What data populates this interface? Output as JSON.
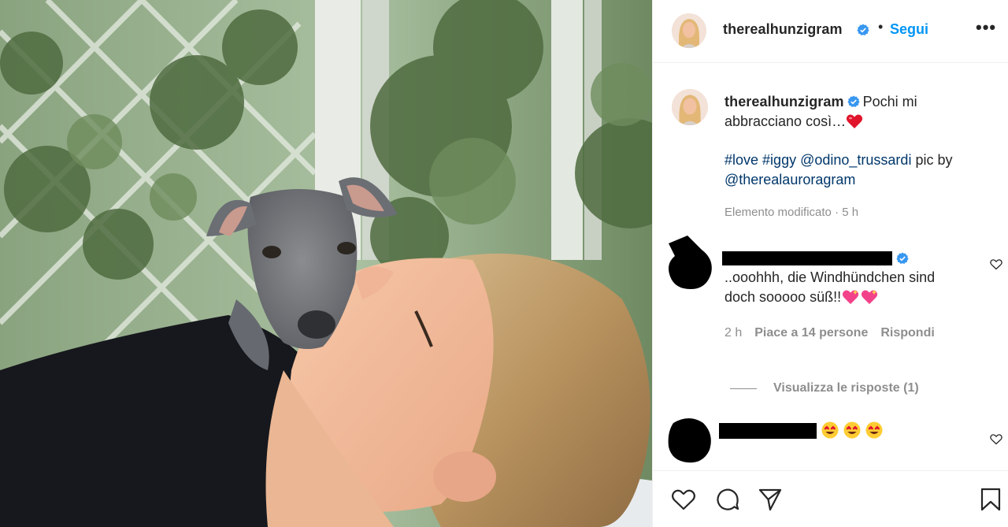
{
  "post": {
    "username": "therealhunzigram",
    "follow_label": "Segui",
    "more_label": "•••",
    "separator": "•"
  },
  "caption": {
    "username": "therealhunzigram",
    "text": "Pochi mi abbracciano così…",
    "hashtag_love": "#love",
    "hashtag_iggy": "#iggy",
    "mention_1": "@odino_trussardi",
    "plain_text": "pic by",
    "mention_2": "@therealauroragram",
    "meta": "Elemento modificato · 5 h"
  },
  "comments": [
    {
      "text_line1": "..ooohhh, die Windhündchen sind",
      "text_line2": "doch sooooo süß!!",
      "time": "2 h",
      "likes": "Piace a 14 persone",
      "reply": "Rispondi",
      "view_replies": "Visualizza le risposte (1)"
    },
    {
      "text": ""
    }
  ],
  "icons": {
    "verified": "verified-badge-icon",
    "like": "heart-icon",
    "comment": "comment-icon",
    "share": "paper-plane-icon",
    "save": "bookmark-icon"
  },
  "colors": {
    "accent": "#0095f6",
    "hashtag": "#00376b",
    "muted": "#8e8e8e",
    "text": "#262626"
  }
}
